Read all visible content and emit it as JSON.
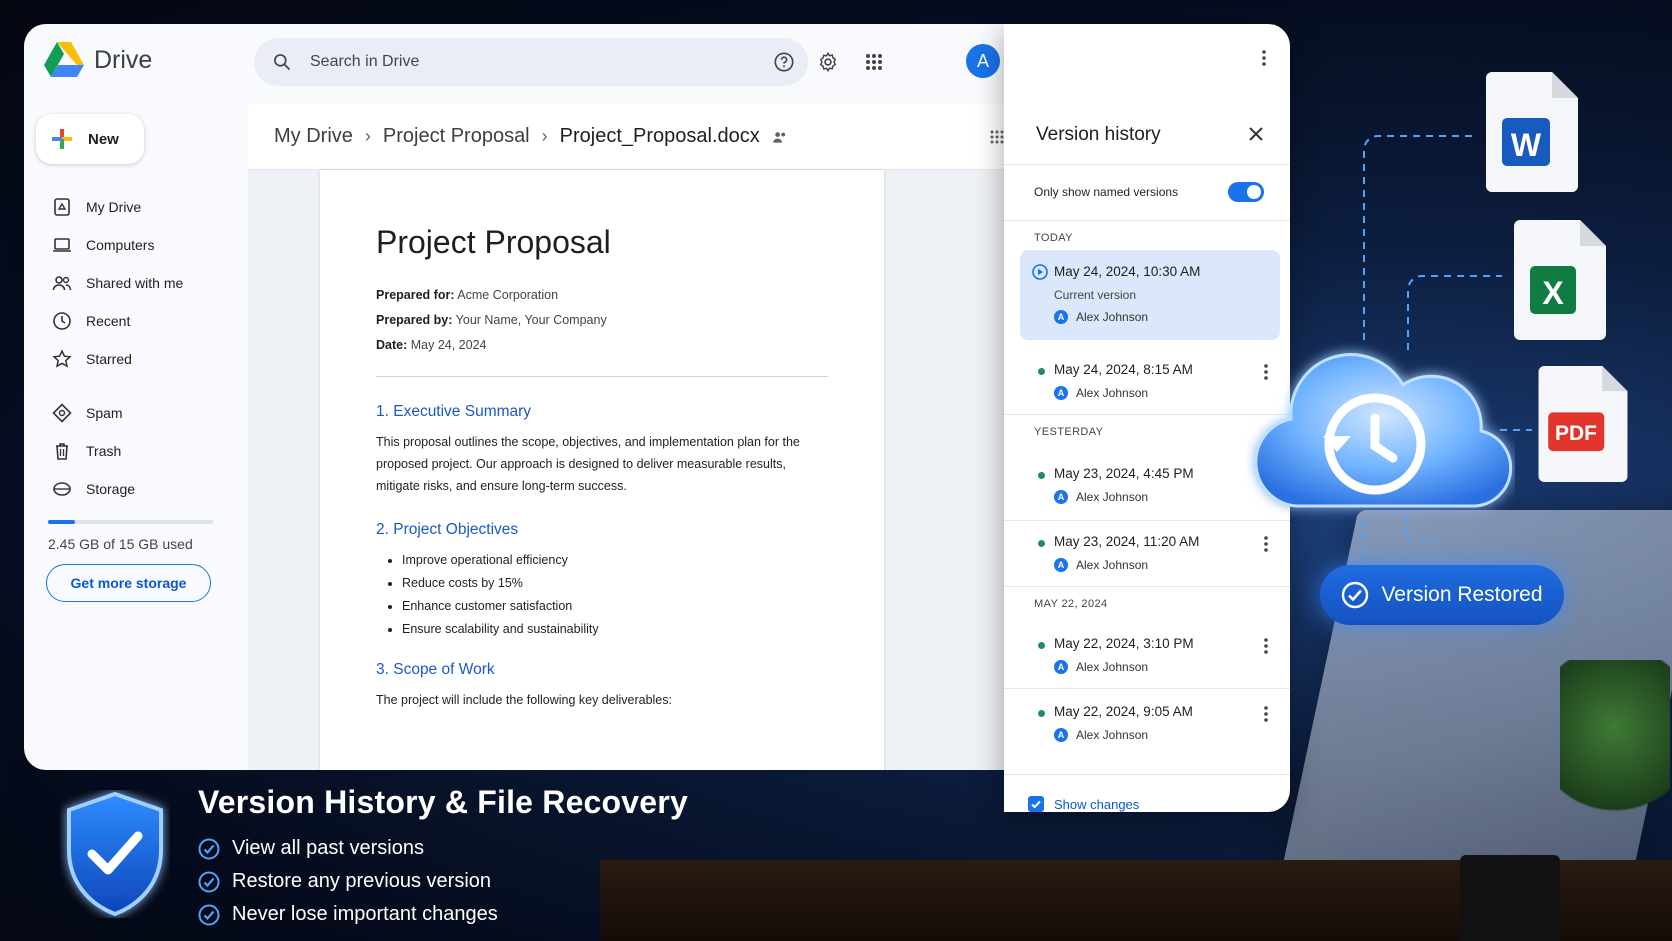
{
  "app": {
    "name": "Drive"
  },
  "search": {
    "placeholder": "Search in Drive"
  },
  "header": {
    "avatar_letter": "A"
  },
  "sidebar": {
    "new_label": "New",
    "items": [
      {
        "label": "My Drive",
        "icon": "my-drive-icon"
      },
      {
        "label": "Computers",
        "icon": "computer-icon"
      },
      {
        "label": "Shared with me",
        "icon": "people-icon"
      },
      {
        "label": "Recent",
        "icon": "clock-icon"
      },
      {
        "label": "Starred",
        "icon": "star-icon"
      },
      {
        "label": "Spam",
        "icon": "spam-icon"
      },
      {
        "label": "Trash",
        "icon": "trash-icon"
      },
      {
        "label": "Storage",
        "icon": "cloud-icon"
      }
    ],
    "storage": {
      "used_text": "2.45 GB of 15 GB used",
      "used_fraction": 0.163,
      "button_label": "Get more storage"
    }
  },
  "breadcrumb": {
    "items": [
      "My Drive",
      "Project Proposal",
      "Project_Proposal.docx"
    ]
  },
  "document": {
    "title": "Project Proposal",
    "meta": [
      {
        "label": "Prepared for:",
        "value": "Acme Corporation"
      },
      {
        "label": "Prepared by:",
        "value": "Your Name, Your Company"
      },
      {
        "label": "Date:",
        "value": "May 24, 2024"
      }
    ],
    "sections": {
      "s1_heading": "1.  Executive Summary",
      "s1_body": "This proposal outlines the scope, objectives, and implementation plan for the proposed project. Our approach is designed to deliver measurable results, mitigate risks, and ensure long-term success.",
      "s2_heading": "2.  Project Objectives",
      "s2_bullets": [
        "Improve operational efficiency",
        "Reduce costs by 15%",
        "Enhance customer satisfaction",
        "Ensure scalability and sustainability"
      ],
      "s3_heading": "3.  Scope of Work",
      "s3_body": "The project will include the following key deliverables:"
    }
  },
  "version_history": {
    "title": "Version history",
    "toggle_label": "Only show named versions",
    "toggle_on": true,
    "sections": {
      "today": "TODAY",
      "yesterday": "YESTERDAY",
      "may22": "MAY 22, 2024"
    },
    "versions": [
      {
        "date": "May 24, 2024, 10:30 AM",
        "sub": "Current version",
        "user": "Alex Johnson"
      },
      {
        "date": "May 24, 2024, 8:15 AM",
        "user": "Alex Johnson"
      },
      {
        "date": "May 23, 2024, 4:45 PM",
        "user": "Alex Johnson"
      },
      {
        "date": "May 23, 2024, 11:20 AM",
        "user": "Alex Johnson"
      },
      {
        "date": "May 22, 2024, 3:10 PM",
        "user": "Alex Johnson"
      },
      {
        "date": "May 22, 2024, 9:05 AM",
        "user": "Alex Johnson"
      }
    ],
    "user_initial": "A",
    "show_changes_label": "Show changes",
    "show_changes_checked": true
  },
  "illustration": {
    "file_labels": {
      "word": "W",
      "excel": "X",
      "pdf": "PDF"
    },
    "badge": "Version Restored",
    "colors": {
      "word": "#185abd",
      "excel": "#107c41",
      "pdf": "#e0342c",
      "accent": "#1a73e8"
    }
  },
  "promo": {
    "title": "Version History & File Recovery",
    "items": [
      "View all past versions",
      "Restore any previous version",
      "Never lose important changes"
    ]
  }
}
